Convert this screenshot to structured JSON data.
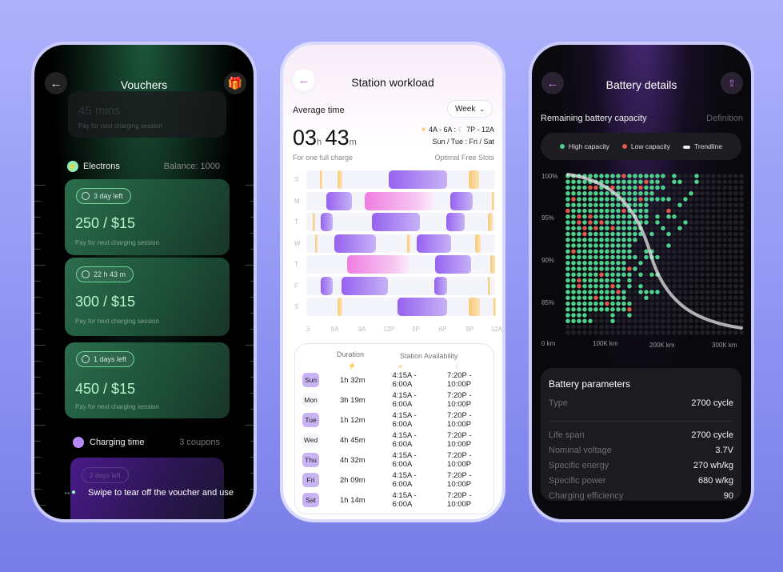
{
  "colors": {
    "high": "#4fd08a",
    "low": "#e0584a",
    "empty": "#202027",
    "accent_purple": "#9662f0",
    "free_slot": "#f7c97a"
  },
  "vouchers": {
    "title": "Vouchers",
    "back_icon": "arrow-left-icon",
    "gift_icon": "gift-icon",
    "faded_card": {
      "value": "45 mins",
      "subtitle": "Pay for next charging session"
    },
    "electrons": {
      "label": "Electrons",
      "balance": "Balance: 1000"
    },
    "cards": [
      {
        "badge": "3 day left",
        "price": "250 / $15",
        "subtitle": "Pay for next charging session"
      },
      {
        "badge": "22 h 43 m",
        "price": "300 / $15",
        "subtitle": "Pay for next charging session"
      },
      {
        "badge": "1 days left",
        "price": "450 / $15",
        "subtitle": "Pay for next charging session"
      }
    ],
    "charging": {
      "label": "Charging time",
      "count": "3 coupons",
      "badge": "2 days left"
    },
    "hint": "Swipe to tear off the voucher and use"
  },
  "workload": {
    "title": "Station workload",
    "average_label": "Average time",
    "period": "Week",
    "hours": "03",
    "h_unit": "h",
    "minutes": "43",
    "m_unit": "m",
    "caption": "For one full charge",
    "slot_times": "4A - 6A : ",
    "slot_times2": "7P - 12A",
    "slot_days": "Sun / Tue : Fri / Sat",
    "slots_label": "Optimal Free Slots",
    "chart_data": {
      "type": "timeline",
      "x_ticks": [
        "3",
        "6A",
        "9A",
        "12P",
        "3P",
        "6P",
        "9P",
        "12A"
      ],
      "x_range": [
        3,
        24
      ],
      "rows": [
        {
          "day": "S",
          "bars": [
            [
              4.5,
              4.75,
              "y"
            ],
            [
              6.5,
              7.0,
              "y"
            ],
            [
              12.2,
              18.7,
              "p"
            ],
            [
              21.1,
              22.2,
              "y"
            ]
          ]
        },
        {
          "day": "M",
          "bars": [
            [
              5.2,
              8.1,
              "p"
            ],
            [
              9.5,
              17.2,
              "k"
            ],
            [
              19.0,
              21.5,
              "p"
            ],
            [
              23.6,
              23.8,
              "y"
            ]
          ]
        },
        {
          "day": "T",
          "bars": [
            [
              3.7,
              3.95,
              "y"
            ],
            [
              4.6,
              5.9,
              "p"
            ],
            [
              10.3,
              15.6,
              "p"
            ],
            [
              18.6,
              20.6,
              "p"
            ],
            [
              23.2,
              23.7,
              "y"
            ]
          ]
        },
        {
          "day": "W",
          "bars": [
            [
              4.0,
              4.25,
              "y"
            ],
            [
              6.1,
              10.7,
              "p"
            ],
            [
              14.2,
              14.6,
              "y"
            ],
            [
              15.3,
              19.1,
              "p"
            ],
            [
              21.8,
              22.4,
              "y"
            ]
          ]
        },
        {
          "day": "T",
          "bars": [
            [
              7.5,
              14.6,
              "k"
            ],
            [
              17.3,
              21.3,
              "p"
            ],
            [
              23.5,
              24,
              "y"
            ]
          ]
        },
        {
          "day": "F",
          "bars": [
            [
              4.6,
              5.9,
              "p"
            ],
            [
              6.9,
              12.1,
              "p"
            ],
            [
              17.2,
              18.7,
              "p"
            ],
            [
              23.2,
              23.4,
              "y"
            ]
          ]
        },
        {
          "day": "S",
          "bars": [
            [
              6.5,
              7.0,
              "y"
            ],
            [
              13.1,
              18.7,
              "p"
            ],
            [
              21.1,
              22.3,
              "y"
            ],
            [
              23.8,
              24,
              "y"
            ]
          ]
        }
      ]
    },
    "table": {
      "duration_header": "Duration",
      "availability_header": "Station Availability",
      "rows": [
        {
          "day": "Sun",
          "duration": "1h 32m",
          "morning": "4:15A - 6:00A",
          "evening": "7:20P - 10:00P",
          "highlight": true
        },
        {
          "day": "Mon",
          "duration": "3h 19m",
          "morning": "4:15A - 6:00A",
          "evening": "7:20P - 10:00P",
          "highlight": false
        },
        {
          "day": "Tue",
          "duration": "1h 12m",
          "morning": "4:15A - 6:00A",
          "evening": "7:20P - 10:00P",
          "highlight": true
        },
        {
          "day": "Wed",
          "duration": "4h 45m",
          "morning": "4:15A - 6:00A",
          "evening": "7:20P - 10:00P",
          "highlight": false
        },
        {
          "day": "Thu",
          "duration": "4h 32m",
          "morning": "4:15A - 6:00A",
          "evening": "7:20P - 10:00P",
          "highlight": true
        },
        {
          "day": "Fri",
          "duration": "2h 09m",
          "morning": "4:15A - 6:00A",
          "evening": "7:20P - 10:00P",
          "highlight": true
        },
        {
          "day": "Sat",
          "duration": "1h 14m",
          "morning": "4:15A - 6:00A",
          "evening": "7:20P - 10:00P",
          "highlight": true
        }
      ]
    }
  },
  "battery": {
    "title": "Battery details",
    "section": "Remaining battery capacity",
    "definition": "Definition",
    "chart_data": {
      "type": "scatter",
      "legend": [
        "High capacity",
        "Low capacity",
        "Trendline"
      ],
      "legend_placement": "top",
      "y_ticks": [
        "100%",
        "95%",
        "90%",
        "85%"
      ],
      "x_ticks": [
        "0 km",
        "100K km",
        "200K km",
        "300K km"
      ]
    },
    "params_title": "Battery parameters",
    "params": [
      {
        "label": "Type",
        "value": "2700 cycle"
      },
      {
        "label": "Life span",
        "value": "2700 cycle"
      },
      {
        "label": "Nominal voltage",
        "value": "3.7V"
      },
      {
        "label": "Specific energy",
        "value": "270 wh/kg"
      },
      {
        "label": "Specific power",
        "value": "680 w/kg"
      },
      {
        "label": "Charging efficiency",
        "value": "90"
      }
    ]
  }
}
